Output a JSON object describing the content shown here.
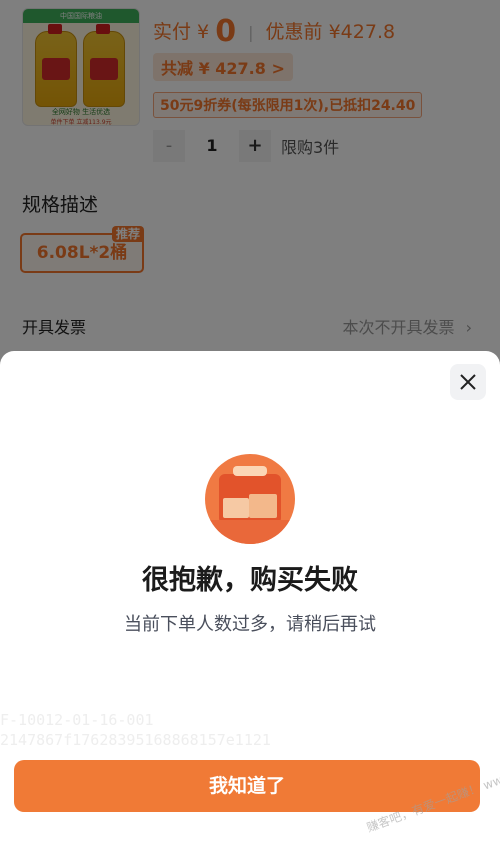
{
  "product": {
    "thumb_band": "中国国际粮油",
    "thumb_caption": "全网好物 生活优选",
    "thumb_caption2": "单件下单 立减113.9元"
  },
  "price": {
    "paid_label": "实付 ¥",
    "paid_value": "0",
    "before_label": "优惠前 ¥427.8"
  },
  "discount": {
    "total_label": "共减 ¥ 427.8",
    "chevron": ">",
    "coupon_text": "50元9折券(每张限用1次),已抵扣24.40"
  },
  "quantity": {
    "minus": "-",
    "value": "1",
    "plus": "+",
    "limit": "限购3件"
  },
  "spec": {
    "title": "规格描述",
    "option": "6.08L*2桶",
    "badge": "推荐"
  },
  "invoice": {
    "label": "开具发票",
    "value": "本次不开具发票",
    "chevron": "›"
  },
  "dialog": {
    "title": "很抱歉，购买失败",
    "message": "当前下单人数过多，请稍后再试",
    "debug_line1": "F-10012-01-16-001",
    "debug_line2": "2147867f17628395168868157e1121",
    "button": "我知道了"
  },
  "watermark": "赚客吧，有爱一起赚！ www.zuanke8.com",
  "colors": {
    "accent": "#f07a36",
    "price": "#f4772d",
    "overlay": "rgba(0,0,0,0.5)"
  },
  "icons": {
    "close": "close-icon",
    "illustration": "empty-box-illustration"
  }
}
